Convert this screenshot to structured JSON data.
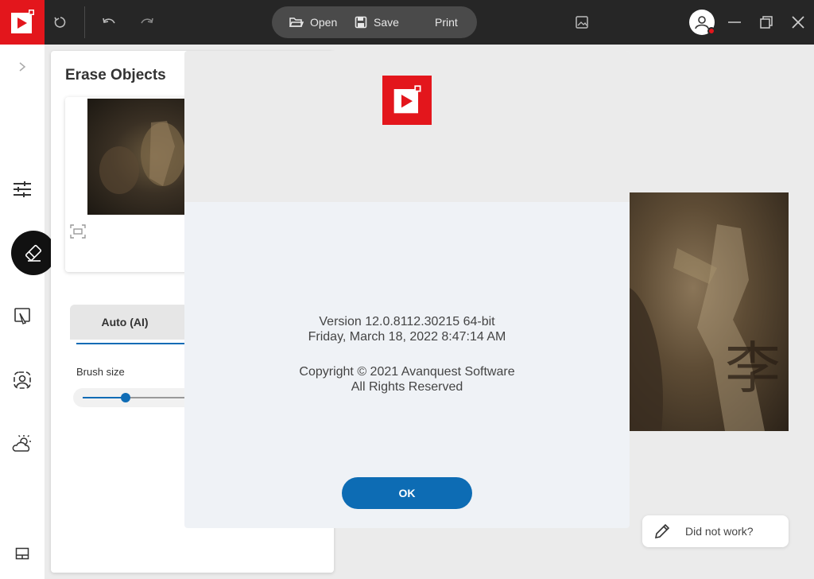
{
  "toolbar": {
    "open_label": "Open",
    "save_label": "Save",
    "print_label": "Print"
  },
  "panel": {
    "title": "Erase Objects",
    "mode_tab_label": "Auto (AI)",
    "brush_size_label": "Brush size",
    "brush_size_value": 0.4
  },
  "dialog": {
    "version": "Version 12.0.8112.30215 64-bit",
    "build_date": "Friday, March 18, 2022 8:47:14 AM",
    "copyright": "Copyright © 2021 Avanquest Software",
    "rights": "All Rights Reserved",
    "ok_label": "OK"
  },
  "feedback": {
    "label": "Did not work?"
  },
  "colors": {
    "brand_red": "#e3161c",
    "accent_blue": "#0d6cb4",
    "titlebar_bg": "#262626"
  }
}
